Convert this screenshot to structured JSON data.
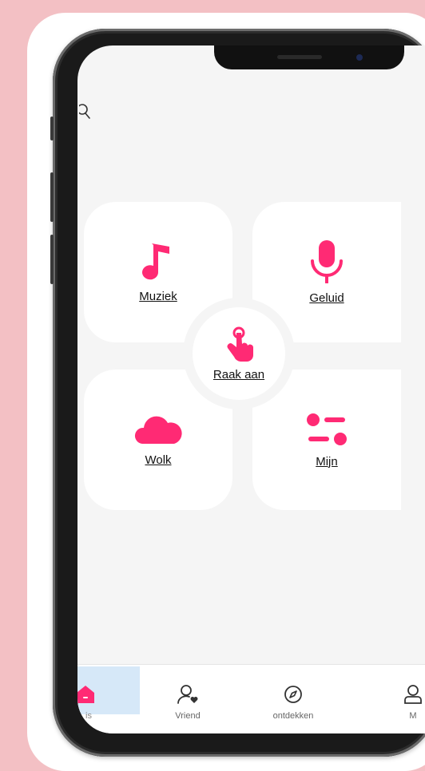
{
  "colors": {
    "accent": "#ff2a74",
    "background": "#f3c0c4",
    "screen": "#f5f5f5",
    "tab_active": "#d6e8f8"
  },
  "tiles": [
    {
      "id": "muziek",
      "label": "Muziek",
      "icon": "music-note-icon"
    },
    {
      "id": "geluid",
      "label": "Geluid",
      "icon": "microphone-icon"
    },
    {
      "id": "wolk",
      "label": "Wolk",
      "icon": "cloud-icon"
    },
    {
      "id": "mijn",
      "label": "Mijn",
      "icon": "toggles-icon"
    }
  ],
  "center": {
    "label": "Raak aan",
    "icon": "touch-hand-icon"
  },
  "tabs": [
    {
      "label": "is",
      "icon": "home-icon",
      "active": true
    },
    {
      "label": "Vriend",
      "icon": "user-heart-icon",
      "active": false
    },
    {
      "label": "ontdekken",
      "icon": "compass-icon",
      "active": false
    },
    {
      "label": "M",
      "icon": "user-icon",
      "active": false
    }
  ]
}
